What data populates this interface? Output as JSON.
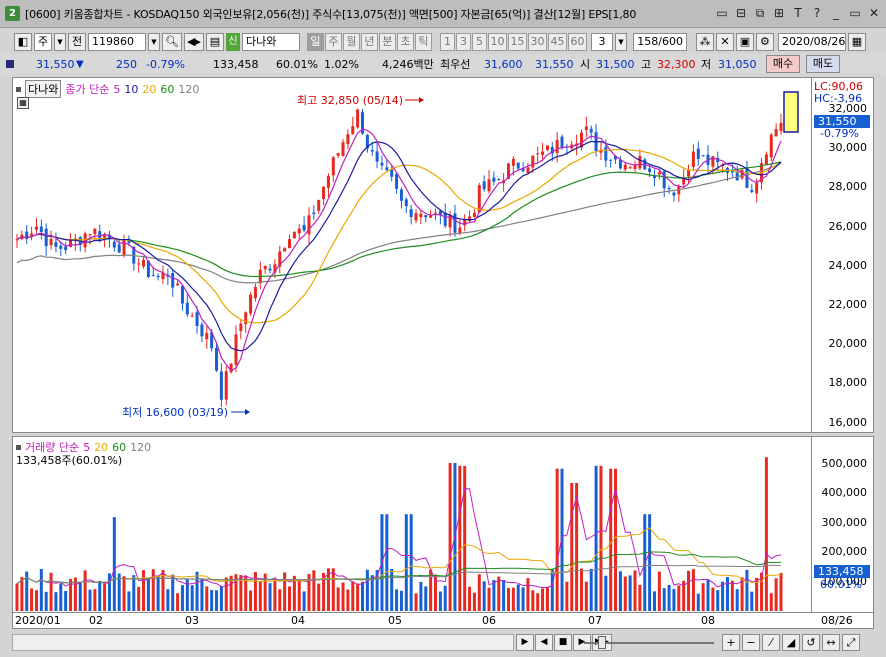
{
  "window": {
    "number": "2",
    "title": "[0600] 키움종합차트 - KOSDAQ150 외국인보유[2,056(천)] 주식수[13,075(천)] 액면[500] 자본금[65(억)] 결산[12월] EPS[1,80"
  },
  "toolbar": {
    "mode": "주",
    "prev": "전",
    "code": "119860",
    "market_tag": "신",
    "name": "다나와",
    "periods": [
      "일",
      "주",
      "월",
      "년",
      "분",
      "초",
      "틱"
    ],
    "active_period": "일",
    "minutes": [
      "1",
      "3",
      "5",
      "10",
      "15",
      "30",
      "45",
      "60"
    ],
    "unit_value": "3",
    "count": "158/600",
    "date": "2020/08/26"
  },
  "quote": {
    "price": "31,550",
    "change": "250",
    "change_pct": "-0.79%",
    "volume": "133,458",
    "vol_ratio": "60.01%",
    "turnover": "1.02%",
    "amount": "4,246백만",
    "best_label": "최우선",
    "best_bid": "31,600",
    "best_ask": "31,550",
    "open_label": "시",
    "open": "31,500",
    "high_label": "고",
    "high": "32,300",
    "low_label": "저",
    "low": "31,050",
    "buy_label": "매수",
    "sell_label": "매도"
  },
  "price_panel": {
    "name_label": "다나와",
    "legend": {
      "title": "종가 단순",
      "ma": [
        "5",
        "10",
        "20",
        "60",
        "120"
      ]
    },
    "lc": "LC:90,06",
    "hc": "HC:-3,96",
    "current": "31,550",
    "current_pct": "-0.79%",
    "high_note": "최고 32,850 (05/14)",
    "low_note": "최저 16,600 (03/19)",
    "yticks": [
      "32,000",
      "30,000",
      "28,000",
      "26,000",
      "24,000",
      "22,000",
      "20,000",
      "18,000",
      "16,000"
    ]
  },
  "volume_panel": {
    "legend": {
      "title": "거래량 단순",
      "ma": [
        "5",
        "20",
        "60",
        "120"
      ]
    },
    "info": "133,458주(60.01%)",
    "current": "133,458",
    "current_pct": "60.01%",
    "yticks": [
      "500,000",
      "400,000",
      "300,000",
      "200,000",
      "100,000"
    ]
  },
  "xaxis": {
    "labels": [
      "2020/01",
      "02",
      "03",
      "04",
      "05",
      "06",
      "07",
      "08",
      "08/26"
    ]
  },
  "colors": {
    "up": "#e8291f",
    "down": "#1660d4",
    "ma5": "#c020c0",
    "ma10": "#1a1aa0",
    "ma20": "#e8a800",
    "ma60": "#1e8c1e",
    "ma120": "#808080"
  },
  "icons": [
    "chart-type-icon",
    "zoom-icon",
    "sound-icon",
    "settings-icon",
    "calendar-icon",
    "play-icon",
    "stop-icon"
  ]
}
